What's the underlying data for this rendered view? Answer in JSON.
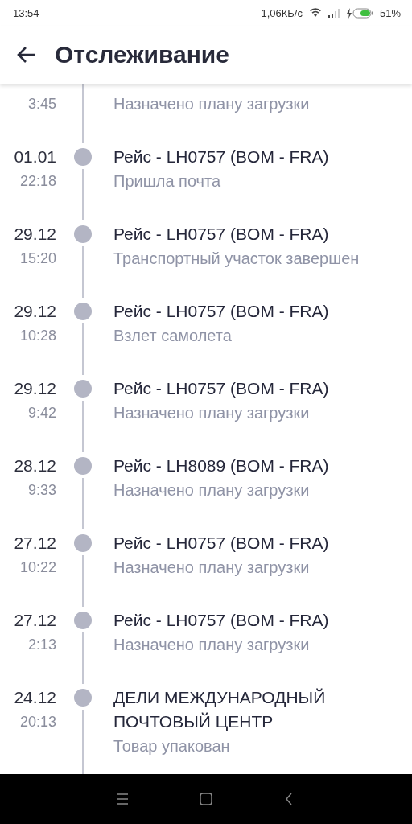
{
  "status_bar": {
    "time": "13:54",
    "speed": "1,06КБ/с",
    "battery": "51%"
  },
  "header": {
    "title": "Отслеживание"
  },
  "events": [
    {
      "time": "3:45",
      "status": "Назначено плану загрузки"
    },
    {
      "date": "01.01",
      "time": "22:18",
      "title": "Рейс - LH0757 (BOM - FRA)",
      "status": "Пришла почта"
    },
    {
      "date": "29.12",
      "time": "15:20",
      "title": "Рейс - LH0757 (BOM - FRA)",
      "status": "Транспортный участок завершен"
    },
    {
      "date": "29.12",
      "time": "10:28",
      "title": "Рейс - LH0757 (BOM - FRA)",
      "status": "Взлет самолета"
    },
    {
      "date": "29.12",
      "time": "9:42",
      "title": "Рейс - LH0757 (BOM - FRA)",
      "status": "Назначено плану загрузки"
    },
    {
      "date": "28.12",
      "time": "9:33",
      "title": "Рейс - LH8089 (BOM - FRA)",
      "status": "Назначено плану загрузки"
    },
    {
      "date": "27.12",
      "time": "10:22",
      "title": "Рейс - LH0757 (BOM - FRA)",
      "status": "Назначено плану загрузки"
    },
    {
      "date": "27.12",
      "time": "2:13",
      "title": "Рейс - LH0757 (BOM - FRA)",
      "status": "Назначено плану загрузки"
    },
    {
      "date": "24.12",
      "time": "20:13",
      "title": "ДЕЛИ МЕЖДУНАРОДНЫЙ ПОЧТОВЫЙ ЦЕНТР",
      "status": "Товар упакован"
    }
  ]
}
